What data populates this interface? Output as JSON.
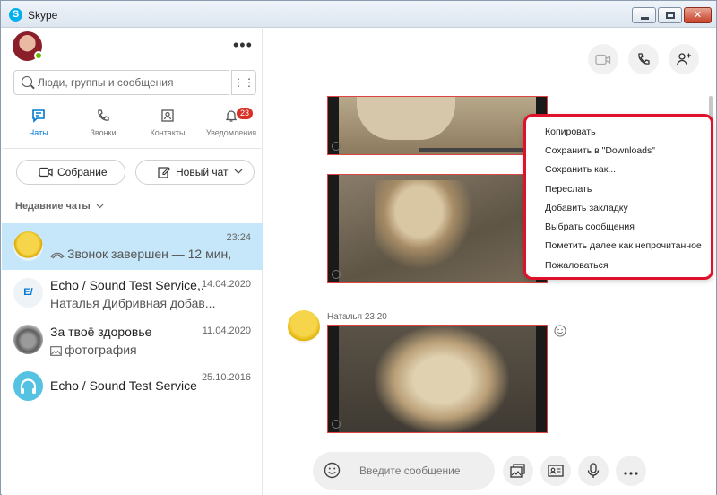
{
  "window": {
    "title": "Skype"
  },
  "sidebar": {
    "more_label": "•••",
    "search": {
      "placeholder": "Люди, группы и сообщения",
      "dialpad_icon": "⋮⋮"
    },
    "nav": [
      {
        "label": "Чаты",
        "icon": "chat-icon"
      },
      {
        "label": "Звонки",
        "icon": "phone-icon"
      },
      {
        "label": "Контакты",
        "icon": "contacts-icon"
      },
      {
        "label": "Уведомления",
        "icon": "bell-icon",
        "badge": "23"
      }
    ],
    "meeting_label": "Собрание",
    "new_chat_label": "Новый чат",
    "recent_header": "Недавние чаты",
    "chats": [
      {
        "name": "",
        "preview": "Звонок завершен — 12 мин,",
        "date": "23:24",
        "selected": true
      },
      {
        "name": "Echo / Sound Test Service,...",
        "preview": "Наталья Дибривная добав...",
        "date": "14.04.2020",
        "avatar_text": "E/"
      },
      {
        "name": "За твоё здоровье",
        "preview": "фотография",
        "date": "11.04.2020"
      },
      {
        "name": "Echo / Sound Test Service",
        "preview": "",
        "date": "25.10.2016"
      }
    ]
  },
  "conversation": {
    "sender": "Наталья",
    "sent_time": "23:20",
    "composer_placeholder": "Введите сообщение"
  },
  "context_menu": {
    "items": [
      "Копировать",
      "Сохранить в \"Downloads\"",
      "Сохранить как...",
      "Переслать",
      "Добавить закладку",
      "Выбрать сообщения",
      "Пометить далее как непрочитанное",
      "Пожаловаться"
    ]
  },
  "colors": {
    "accent": "#0078d4",
    "selected_row": "#c5e7f9",
    "badge": "#d93025",
    "highlight_border": "#e0112b"
  }
}
